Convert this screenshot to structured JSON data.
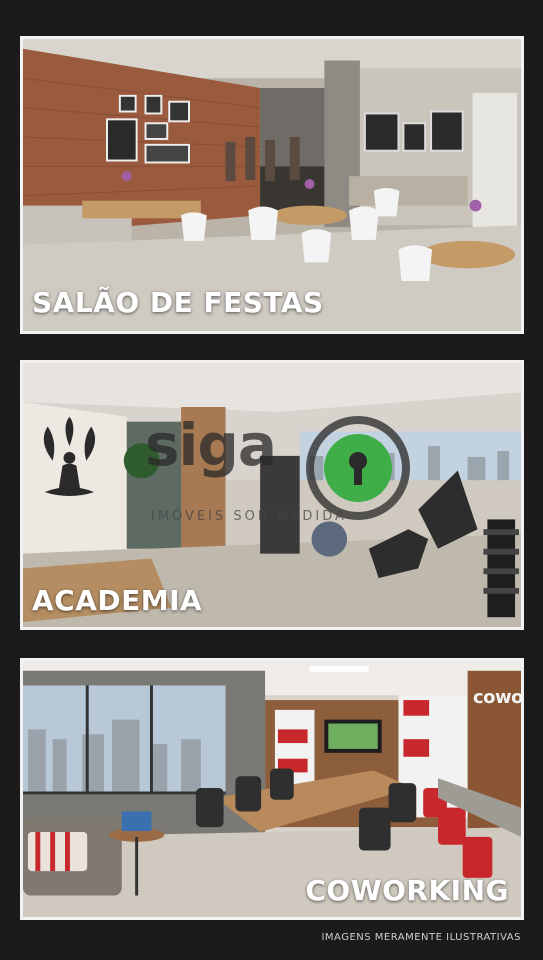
{
  "panels": [
    {
      "caption": "SALÃO DE FESTAS"
    },
    {
      "caption": "ACADEMIA"
    },
    {
      "caption": "COWORKING"
    }
  ],
  "watermark": {
    "brand": "siga",
    "tagline": "IMÓVEIS SOB MEDIDA"
  },
  "wall_sign": "coworking",
  "footer": "IMAGENS MERAMENTE ILUSTRATIVAS",
  "colors": {
    "background": "#1b1b1b",
    "frame": "#f2f2f2",
    "watermark_accent": "#3fae49"
  }
}
